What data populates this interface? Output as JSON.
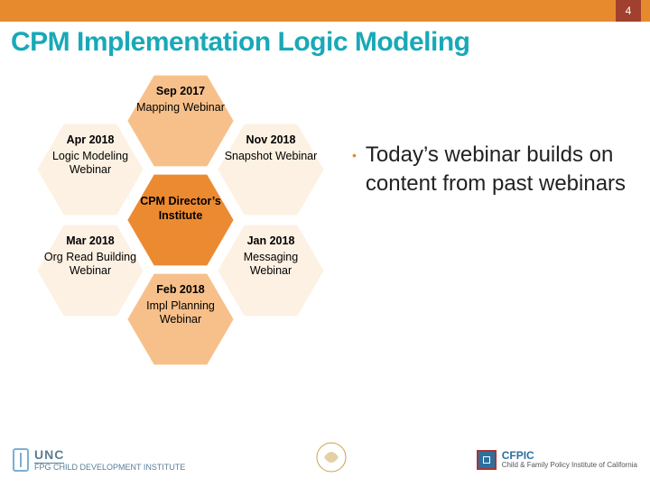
{
  "page_number": "4",
  "title": "CPM Implementation Logic Modeling",
  "hexes": {
    "top": {
      "date": "Sep 2017",
      "name": "Mapping Webinar"
    },
    "ul": {
      "date": "Apr 2018",
      "name": "Logic Modeling Webinar"
    },
    "ur": {
      "date": "Nov 2018",
      "name": "Snapshot Webinar"
    },
    "center": {
      "date": "",
      "name": "CPM Director’s Institute"
    },
    "ll": {
      "date": "Mar 2018",
      "name": "Org Read Building Webinar"
    },
    "lr": {
      "date": "Jan 2018",
      "name": "Messaging Webinar"
    },
    "bottom": {
      "date": "Feb 2018",
      "name": "Impl Planning Webinar"
    }
  },
  "bullet": "Today’s webinar builds on content from past webinars",
  "footer": {
    "unc_top": "UNC",
    "unc_bottom": "FPG CHILD DEVELOPMENT INSTITUTE",
    "cfpic_top": "CFPIC",
    "cfpic_bottom": "Child & Family Policy Institute of California"
  }
}
